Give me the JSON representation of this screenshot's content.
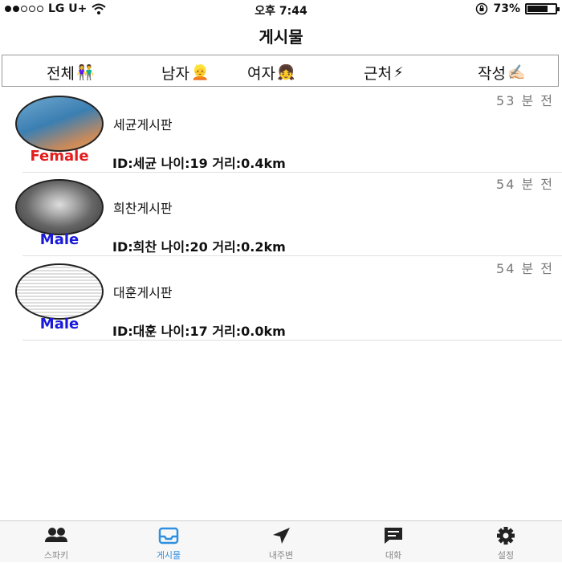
{
  "status": {
    "carrier": "LG U+",
    "time": "오후 7:44",
    "battery_text": "73%",
    "battery_level": 0.73,
    "signal_dots_filled": 2,
    "signal_dots_total": 5
  },
  "nav": {
    "title": "게시물"
  },
  "filters": [
    {
      "label": "전체",
      "emoji": "👫"
    },
    {
      "label": "남자",
      "emoji": "👱"
    },
    {
      "label": "여자",
      "emoji": "👧"
    },
    {
      "label": "근처",
      "emoji": "⚡"
    },
    {
      "label": "작성",
      "emoji": "✍🏻"
    }
  ],
  "posts": [
    {
      "time": "53 분 전",
      "title": "세균게시판",
      "gender": "Female",
      "gender_color": "#e31b1b",
      "info": "ID:세균 나이:19 거리:0.4km"
    },
    {
      "time": "54 분 전",
      "title": "희찬게시판",
      "gender": "Male",
      "gender_color": "#1a1adb",
      "info": "ID:희찬 나이:20 거리:0.2km"
    },
    {
      "time": "54 분 전",
      "title": "대훈게시판",
      "gender": "Male",
      "gender_color": "#1a1adb",
      "info": "ID:대훈 나이:17 거리:0.0km"
    }
  ],
  "tabs": [
    {
      "label": "스파키",
      "icon": "people-icon"
    },
    {
      "label": "게시물",
      "icon": "inbox-icon",
      "active": true
    },
    {
      "label": "내주변",
      "icon": "location-arrow-icon"
    },
    {
      "label": "대화",
      "icon": "chat-bubble-icon"
    },
    {
      "label": "설정",
      "icon": "gear-icon"
    }
  ],
  "colors": {
    "accent": "#2f8fe0",
    "inactive_tab": "#222222"
  }
}
